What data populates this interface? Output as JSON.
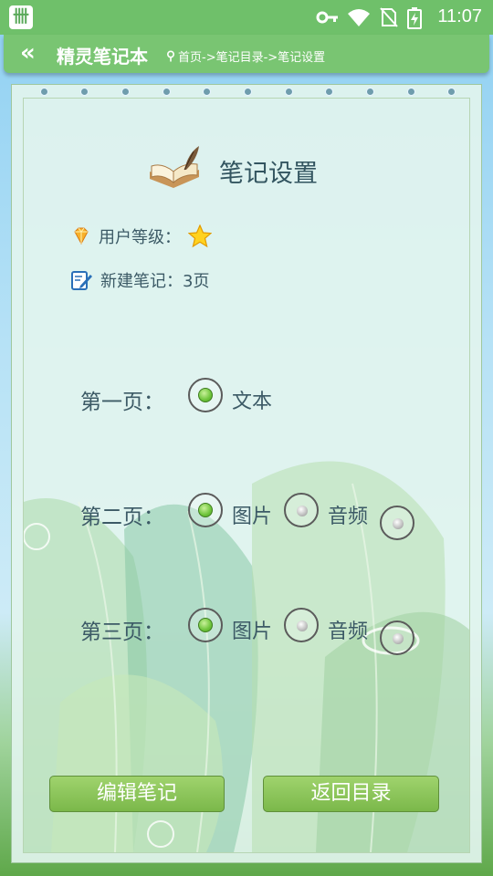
{
  "status_bar": {
    "app_badge": "卌",
    "time": "11:07",
    "icons": [
      "key-icon",
      "wifi-icon",
      "no-sim-icon",
      "battery-charging-icon"
    ]
  },
  "header": {
    "back_icon": "«",
    "title": "精灵笔记本",
    "breadcrumb": "首页->笔记目录->笔记设置"
  },
  "page": {
    "title": "笔记设置",
    "user_level_label": "用户等级：",
    "new_note_label": "新建笔记：3页"
  },
  "rows": [
    {
      "label": "第一页：",
      "options": [
        {
          "text": "文本",
          "checked": true
        }
      ]
    },
    {
      "label": "第二页：",
      "options": [
        {
          "text": "图片",
          "checked": true
        },
        {
          "text": "音频",
          "checked": false
        },
        {
          "text": "",
          "checked": false
        }
      ]
    },
    {
      "label": "第三页：",
      "options": [
        {
          "text": "图片",
          "checked": true
        },
        {
          "text": "音频",
          "checked": false
        },
        {
          "text": "",
          "checked": false
        }
      ]
    }
  ],
  "buttons": {
    "edit": "编辑笔记",
    "back_to_list": "返回目录"
  },
  "colors": {
    "header_green": "#79c572",
    "button_green": "#8cc65a",
    "radio_checked": "#6dc43a"
  }
}
